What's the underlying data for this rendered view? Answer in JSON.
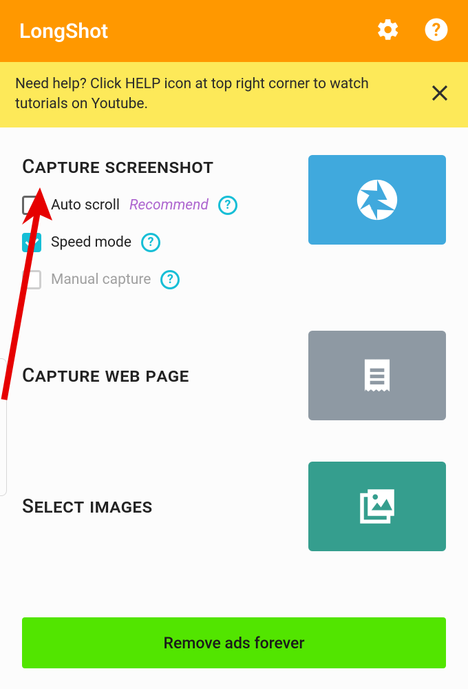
{
  "header": {
    "title": "LongShot"
  },
  "banner": {
    "text": "Need help? Click HELP icon at top right corner to watch tutorials on Youtube."
  },
  "captureScreenshot": {
    "title": "Capture screenshot",
    "autoScroll": {
      "label": "Auto scroll",
      "recommend": "Recommend"
    },
    "speedMode": {
      "label": "Speed mode"
    },
    "manualCapture": {
      "label": "Manual capture"
    }
  },
  "captureWebPage": {
    "title": "Capture web page"
  },
  "selectImages": {
    "title": "Select images"
  },
  "removeAds": {
    "label": "Remove ads forever"
  }
}
